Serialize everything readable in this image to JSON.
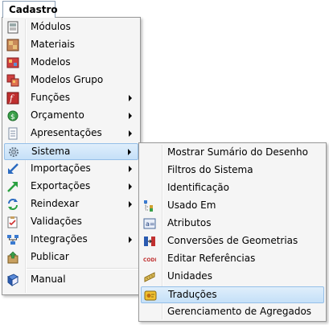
{
  "menubar": {
    "title": "Cadastro"
  },
  "main_menu": {
    "items": [
      {
        "label": "Módulos"
      },
      {
        "label": "Materiais"
      },
      {
        "label": "Modelos"
      },
      {
        "label": "Modelos Grupo"
      },
      {
        "label": "Funções"
      },
      {
        "label": "Orçamento"
      },
      {
        "label": "Apresentações"
      },
      {
        "label": "Sistema"
      },
      {
        "label": "Importações"
      },
      {
        "label": "Exportações"
      },
      {
        "label": "Reindexar"
      },
      {
        "label": "Validações"
      },
      {
        "label": "Integrações"
      },
      {
        "label": "Publicar"
      },
      {
        "label": "Manual"
      }
    ]
  },
  "sub_menu": {
    "items": [
      {
        "label": "Mostrar Sumário do Desenho"
      },
      {
        "label": "Filtros do Sistema"
      },
      {
        "label": "Identificação"
      },
      {
        "label": "Usado Em"
      },
      {
        "label": "Atributos"
      },
      {
        "label": "Conversões de Geometrias"
      },
      {
        "label": "Editar Referências"
      },
      {
        "label": "Unidades"
      },
      {
        "label": "Traduções"
      },
      {
        "label": "Gerenciamento de Agregados"
      }
    ]
  }
}
